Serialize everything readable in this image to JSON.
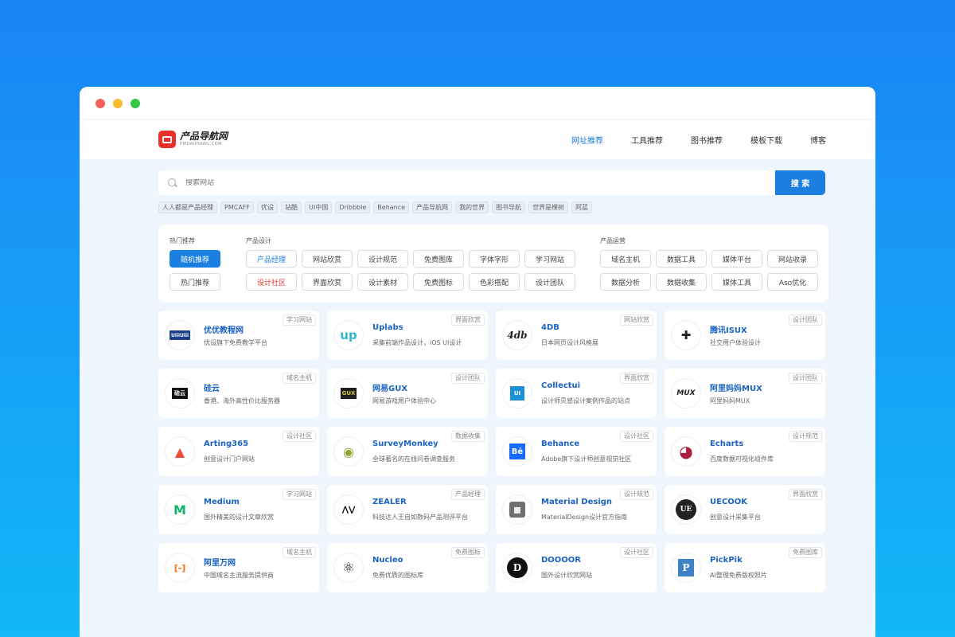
{
  "logo": {
    "name": "产品导航网",
    "sub": "PMDAOHANG.COM"
  },
  "nav": [
    "网址推荐",
    "工具推荐",
    "图书推荐",
    "模板下载",
    "博客"
  ],
  "search": {
    "placeholder": "搜索网站",
    "button": "搜 索"
  },
  "hot_tags": [
    "人人都是产品经理",
    "PMCAFF",
    "优设",
    "站酷",
    "UI中国",
    "Dribbble",
    "Behance",
    "产品导航网",
    "我的世界",
    "图书导航",
    "世界是棵树",
    "阿蓝"
  ],
  "categories": {
    "hot": {
      "title": "热门推荐",
      "items": [
        "随机推荐",
        "热门推荐"
      ]
    },
    "design": {
      "title": "产品设计",
      "items": [
        "产品经理",
        "网站欣赏",
        "设计规范",
        "免费图库",
        "字体字形",
        "学习网站",
        "设计社区",
        "界面欣赏",
        "设计素材",
        "免费图标",
        "色彩搭配",
        "设计团队"
      ]
    },
    "ops": {
      "title": "产品运营",
      "items": [
        "域名主机",
        "数据工具",
        "媒体平台",
        "网站收录",
        "数据分析",
        "数据收集",
        "媒体工具",
        "Aso优化"
      ]
    }
  },
  "cards": [
    {
      "title": "优优教程网",
      "desc": "优设旗下免费教学平台",
      "tag": "学习网站",
      "icon": "uiiiuiii-logo-icon",
      "icon_text": "UiiiUiii"
    },
    {
      "title": "Uplabs",
      "desc": "采集前端作品设计，iOS UI设计",
      "tag": "界面欣赏",
      "icon": "uplabs-logo-icon",
      "icon_text": "up"
    },
    {
      "title": "4DB",
      "desc": "日本网页设计风格展",
      "tag": "网站欣赏",
      "icon": "4db-logo-icon",
      "icon_text": "4db"
    },
    {
      "title": "腾讯ISUX",
      "desc": "社交用户体验设计",
      "tag": "设计团队",
      "icon": "isux-logo-icon",
      "icon_text": "✚"
    },
    {
      "title": "硅云",
      "desc": "香港、海外高性价比服务器",
      "tag": "域名主机",
      "icon": "guiyun-logo-icon",
      "icon_text": "硅云"
    },
    {
      "title": "网易GUX",
      "desc": "网易游戏用户体验中心",
      "tag": "设计团队",
      "icon": "gux-logo-icon",
      "icon_text": "GUX"
    },
    {
      "title": "Collectui",
      "desc": "设计师灵感设计案例作品的站点",
      "tag": "界面欣赏",
      "icon": "collectui-logo-icon",
      "icon_text": "UI"
    },
    {
      "title": "阿里妈妈MUX",
      "desc": "阿里妈妈MUX",
      "tag": "设计团队",
      "icon": "mux-logo-icon",
      "icon_text": "MUX"
    },
    {
      "title": "Arting365",
      "desc": "创意设计门户网站",
      "tag": "设计社区",
      "icon": "arting365-logo-icon",
      "icon_text": "▲"
    },
    {
      "title": "SurveyMonkey",
      "desc": "全球著名的在线问卷调查服务",
      "tag": "数据收集",
      "icon": "surveymonkey-logo-icon",
      "icon_text": "◉"
    },
    {
      "title": "Behance",
      "desc": "Adobe旗下设计师创意视觉社区",
      "tag": "设计社区",
      "icon": "behance-logo-icon",
      "icon_text": "Bē"
    },
    {
      "title": "Echarts",
      "desc": "百度数据可视化组件库",
      "tag": "设计规范",
      "icon": "echarts-logo-icon",
      "icon_text": "◕"
    },
    {
      "title": "Medium",
      "desc": "国外精美的设计文章欣赏",
      "tag": "学习网站",
      "icon": "medium-logo-icon",
      "icon_text": "M"
    },
    {
      "title": "ZEALER",
      "desc": "科技达人王自如数码产品测评平台",
      "tag": "产品经理",
      "icon": "zealer-logo-icon",
      "icon_text": "⋀⋁"
    },
    {
      "title": "Material Design",
      "desc": "MaterialDesign设计官方指南",
      "tag": "设计规范",
      "icon": "material-design-logo-icon",
      "icon_text": "◼"
    },
    {
      "title": "UECOOK",
      "desc": "创意设计采集平台",
      "tag": "界面欣赏",
      "icon": "uecook-logo-icon",
      "icon_text": "UE"
    },
    {
      "title": "阿里万网",
      "desc": "中国域名主流服务提供商",
      "tag": "域名主机",
      "icon": "aliyun-logo-icon",
      "icon_text": "[-]"
    },
    {
      "title": "Nucleo",
      "desc": "免费优质的图标库",
      "tag": "免费图标",
      "icon": "nucleo-logo-icon",
      "icon_text": "⚛"
    },
    {
      "title": "DOOOOR",
      "desc": "国外设计欣赏网站",
      "tag": "设计社区",
      "icon": "dooooor-logo-icon",
      "icon_text": "D"
    },
    {
      "title": "PickPik",
      "desc": "AI整理免费版权照片",
      "tag": "免费图库",
      "icon": "pickpik-logo-icon",
      "icon_text": "P"
    }
  ],
  "colors": {
    "accent": "#1a7fe0",
    "link": "#1a63c4",
    "red": "#e8312a"
  }
}
